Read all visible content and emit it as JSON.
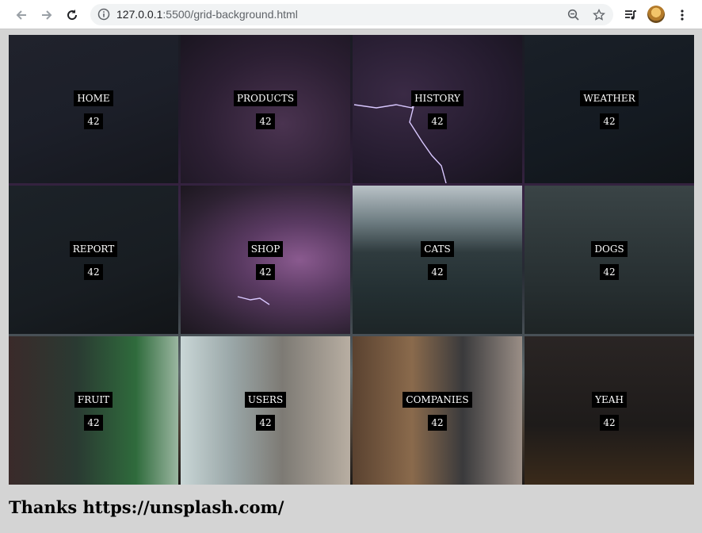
{
  "browser": {
    "url_host": "127.0.0.1",
    "url_rest": ":5500/grid-background.html"
  },
  "grid": {
    "cells": [
      {
        "label": "HOME",
        "count": "42",
        "bg": "linear-gradient(160deg,#20222c 0%,#1c1f29 50%,#15171d 100%)"
      },
      {
        "label": "PRODUCTS",
        "count": "42",
        "bg": "radial-gradient(ellipse at 60% 60%,#4a3350 0%,#2c1f33 55%,#1a1520 100%)"
      },
      {
        "label": "HISTORY",
        "count": "42",
        "bg": "radial-gradient(ellipse at 30% 40%,#3a2a45 0%,#241b2e 60%,#16131c 100%)"
      },
      {
        "label": "WEATHER",
        "count": "42",
        "bg": "linear-gradient(160deg,#1a2028 0%,#141a21 60%,#101418 100%)"
      },
      {
        "label": "REPORT",
        "count": "42",
        "bg": "linear-gradient(160deg,#1c2228 0%,#181d22 60%,#121518 100%)"
      },
      {
        "label": "SHOP",
        "count": "42",
        "bg": "radial-gradient(ellipse at 70% 50%,#8a5a8f 0%,#5a3a62 35%,#2e2233 75%,#1c171f 100%)"
      },
      {
        "label": "CATS",
        "count": "42",
        "bg": "linear-gradient(180deg,#b9c2c7 0%,#6c7b80 25%,#2f3b3e 45%,#243033 70%,#1d2527 100%)"
      },
      {
        "label": "DOGS",
        "count": "42",
        "bg": "linear-gradient(180deg,#3a4446 0%,#2e3739 40%,#262e30 70%,#1e2425 100%)"
      },
      {
        "label": "FRUIT",
        "count": "42",
        "bg": "linear-gradient(90deg,#3a2a2a 0%,#2a3a32 40%,#2f6b3c 75%,#9ab6a0 100%)"
      },
      {
        "label": "USERS",
        "count": "42",
        "bg": "linear-gradient(90deg,#c9d6d6 0%,#9aa7a8 30%,#7d7a74 60%,#b8aea2 100%)"
      },
      {
        "label": "COMPANIES",
        "count": "42",
        "bg": "linear-gradient(90deg,#5a4230 0%,#8a6a4c 35%,#3a3a3c 65%,#9a8e86 100%)"
      },
      {
        "label": "YEAH",
        "count": "42",
        "bg": "linear-gradient(180deg,#2a2524 0%,#1e1b1a 60%,#3a2a1a 100%)"
      }
    ]
  },
  "footer": {
    "credit": "Thanks https://unsplash.com/"
  }
}
